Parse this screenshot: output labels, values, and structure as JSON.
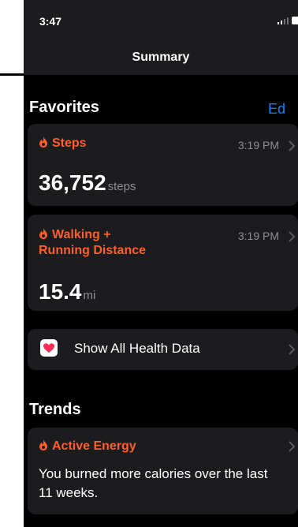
{
  "status_bar": {
    "time": "3:47"
  },
  "nav": {
    "title": "Summary"
  },
  "favorites": {
    "title": "Favorites",
    "edit_label": "Ed",
    "cards": [
      {
        "label": "Steps",
        "time": "3:19 PM",
        "value": "36,752",
        "unit": "steps"
      },
      {
        "label_line1": "Walking +",
        "label_line2": "Running Distance",
        "time": "3:19 PM",
        "value": "15.4",
        "unit": "mi"
      }
    ],
    "show_all_label": "Show All Health Data"
  },
  "trends": {
    "title": "Trends",
    "card": {
      "label": "Active Energy",
      "text": "You burned more calories over the last 11 weeks."
    }
  },
  "colors": {
    "accent": "#ff5e29",
    "link": "#0a84ff",
    "card_bg": "#1c1c1e",
    "heart": "#ff2d55"
  },
  "icons": [
    "flame-icon",
    "chevron-right-icon",
    "heart-icon",
    "signal-icon",
    "battery-icon"
  ]
}
